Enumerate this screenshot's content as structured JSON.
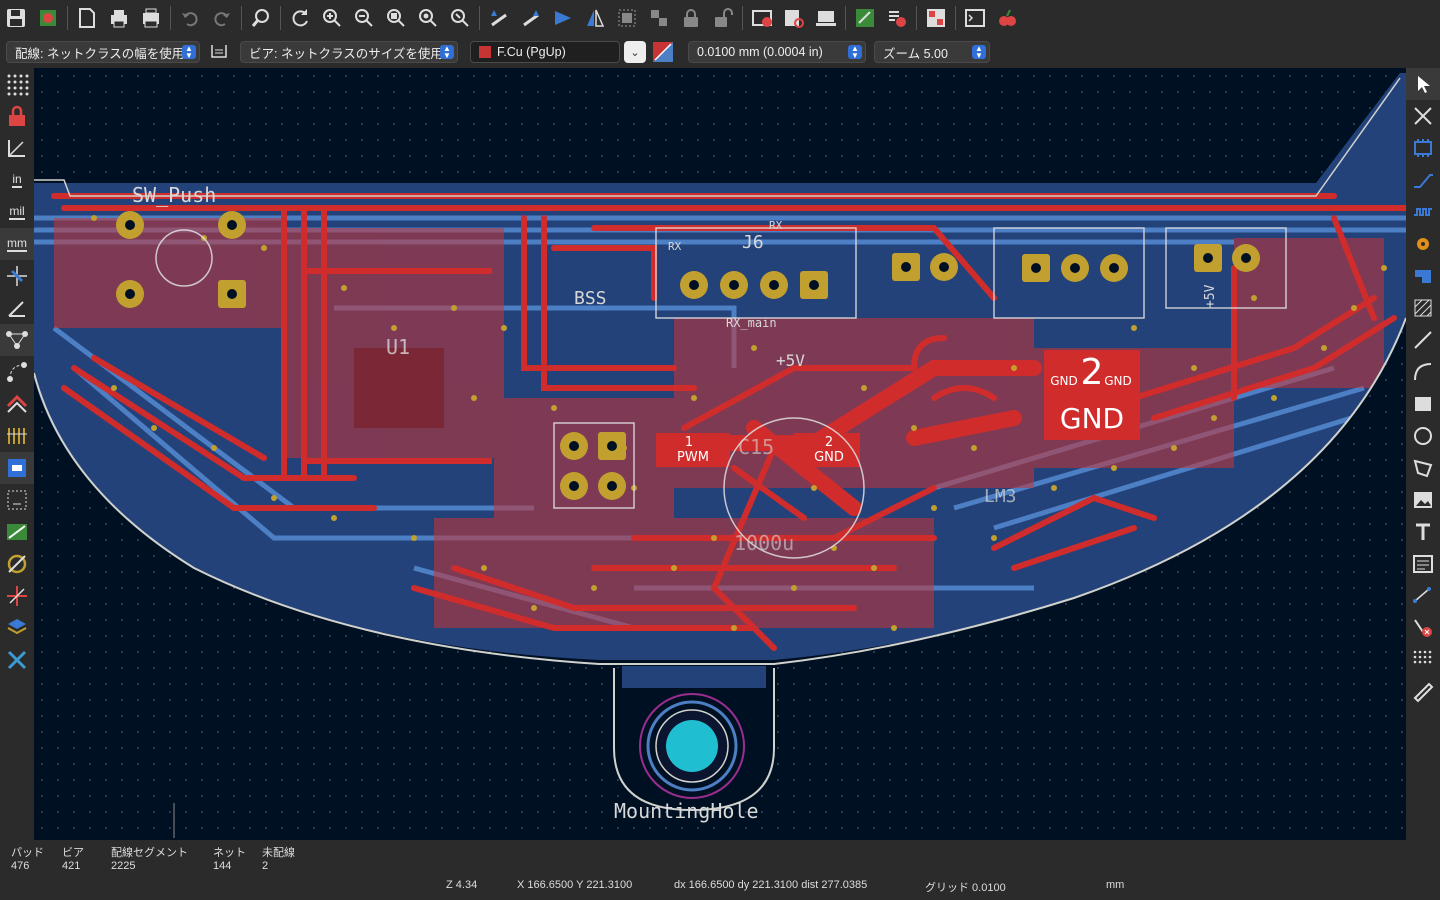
{
  "options_bar": {
    "track_width": "配線: ネットクラスの幅を使用",
    "via_size": "ビア: ネットクラスのサイズを使用",
    "layer": "F.Cu (PgUp)",
    "layer_color": "#c83434",
    "grid": "0.0100 mm (0.0004 in)",
    "zoom": "ズーム 5.00"
  },
  "left_toolbar": {
    "units_in": "in",
    "units_mil": "mil",
    "units_mm": "mm"
  },
  "board": {
    "silk_labels": [
      "SW_Push",
      "J6",
      "RX",
      "RX",
      "RX_main",
      "+5V",
      "BSS",
      "U1",
      "C15",
      "LM3",
      "MountingHole",
      "1000u",
      "+5V"
    ],
    "pad_labels": {
      "pwm_num": "1",
      "pwm_net": "PWM",
      "gnd_num": "2",
      "gnd_net": "GND",
      "big_num": "2",
      "big_net": "GND",
      "small_left": "GND",
      "small_right": "GND"
    },
    "colors": {
      "background": "#001023",
      "front_copper": "#c83434",
      "back_copper": "#4d7fc4",
      "edge_cuts": "#d0d2cd",
      "pad_gold": "#c2a02f",
      "hole": "#1fbfd1"
    }
  },
  "status": {
    "pads_label": "パッド",
    "pads_value": "476",
    "vias_label": "ビア",
    "vias_value": "421",
    "segments_label": "配線セグメント",
    "segments_value": "2225",
    "nets_label": "ネット",
    "nets_value": "144",
    "unrouted_label": "未配線",
    "unrouted_value": "2",
    "zoom": "Z 4.34",
    "xy": "X 166.6500  Y 221.3100",
    "dxdy": "dx 166.6500  dy 221.3100  dist 277.0385",
    "grid": "グリッド 0.0100",
    "units": "mm"
  }
}
